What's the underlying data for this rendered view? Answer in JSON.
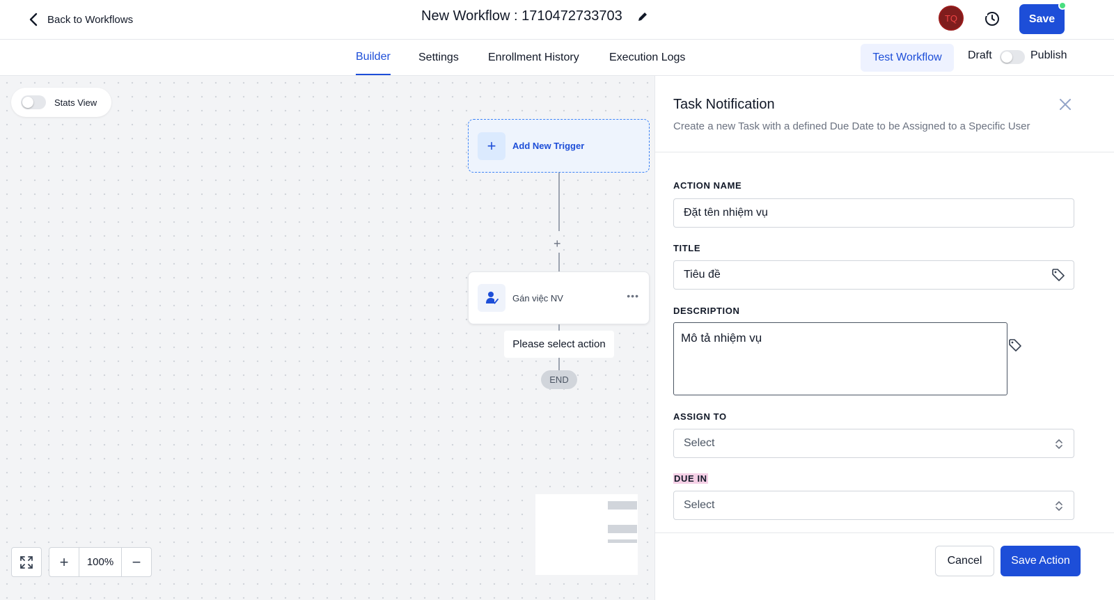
{
  "header": {
    "back_label": "Back to Workflows",
    "workflow_title": "New Workflow : 1710472733703",
    "avatar_initials": "TQ",
    "save_label": "Save"
  },
  "subnav": {
    "tabs": [
      {
        "label": "Builder",
        "active": true
      },
      {
        "label": "Settings",
        "active": false
      },
      {
        "label": "Enrollment History",
        "active": false
      },
      {
        "label": "Execution Logs",
        "active": false
      }
    ],
    "test_label": "Test Workflow",
    "draft_label": "Draft",
    "publish_label": "Publish"
  },
  "canvas": {
    "stats_label": "Stats View",
    "trigger_label": "Add New Trigger",
    "action_node_label": "Gán việc NV",
    "tooltip": "Please select action",
    "end_label": "END",
    "zoom": "100%"
  },
  "panel": {
    "title": "Task Notification",
    "subtitle": "Create a new Task with a defined Due Date to be Assigned to a Specific User",
    "action_name_label": "ACTION NAME",
    "action_name_value": "Đặt tên nhiệm vụ",
    "title_label": "TITLE",
    "title_value": "Tiêu đề",
    "description_label": "DESCRIPTION",
    "description_value": "Mô tả nhiệm vụ",
    "assign_label": "ASSIGN TO",
    "assign_value": "Select",
    "due_label": "DUE IN",
    "due_value": "Select",
    "cancel_label": "Cancel",
    "save_action_label": "Save Action"
  },
  "colors": {
    "primary": "#1d4ed8",
    "publish_dot": "#4ade80",
    "avatar_bg": "#7f1d1d"
  }
}
